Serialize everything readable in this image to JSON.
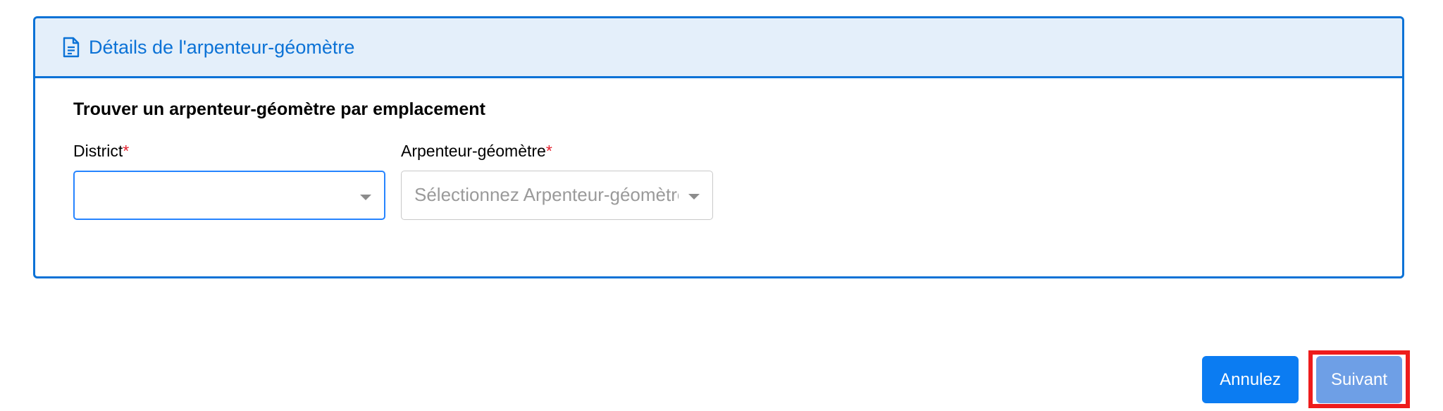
{
  "card": {
    "icon": "document-icon",
    "title": "Détails de l'arpenteur-géomètre"
  },
  "form": {
    "heading": "Trouver un arpenteur-géomètre par emplacement",
    "district": {
      "label": "District",
      "required_marker": "*",
      "value": ""
    },
    "surveyor": {
      "label": "Arpenteur-géomètre",
      "required_marker": "*",
      "placeholder": "Sélectionnez Arpenteur-géomètre"
    }
  },
  "actions": {
    "cancel_label": "Annulez",
    "next_label": "Suivant"
  },
  "colors": {
    "accent": "#0b72d6",
    "header_bg": "#e4effa",
    "required": "#e41f2d",
    "cancel_button": "#0b7cf2",
    "next_button": "#6e9fe6",
    "highlight": "#ee1c1c"
  }
}
